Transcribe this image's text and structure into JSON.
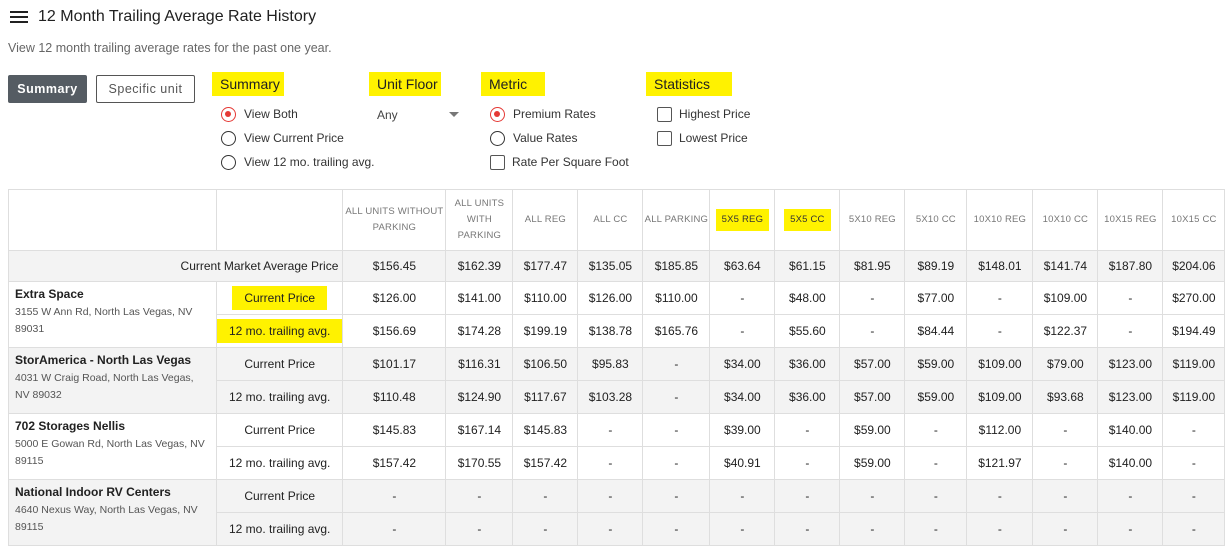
{
  "header": {
    "title": "12 Month Trailing Average Rate History",
    "subtitle": "View 12 month trailing average rates for the past one year."
  },
  "view_buttons": {
    "summary": "Summary",
    "specific_unit": "Specific unit"
  },
  "filters": {
    "summary": {
      "heading": "Summary",
      "options": [
        {
          "label": "View Both",
          "selected": true
        },
        {
          "label": "View Current Price",
          "selected": false
        },
        {
          "label": "View 12 mo. trailing avg.",
          "selected": false
        }
      ]
    },
    "unit_floor": {
      "heading": "Unit Floor",
      "value": "Any"
    },
    "metric": {
      "heading": "Metric",
      "options": [
        {
          "label": "Premium Rates",
          "selected": true
        },
        {
          "label": "Value Rates",
          "selected": false
        }
      ],
      "checkbox": {
        "label": "Rate Per Square Foot",
        "checked": false
      }
    },
    "statistics": {
      "heading": "Statistics",
      "checkboxes": [
        {
          "label": "Highest Price",
          "checked": false
        },
        {
          "label": "Lowest Price",
          "checked": false
        }
      ]
    }
  },
  "table": {
    "columns": [
      "ALL UNITS WITHOUT PARKING",
      "ALL UNITS WITH PARKING",
      "ALL REG",
      "ALL CC",
      "ALL PARKING",
      "5X5 REG",
      "5X5 CC",
      "5X10 REG",
      "5X10 CC",
      "10X10 REG",
      "10X10 CC",
      "10X15 REG",
      "10X15 CC"
    ],
    "market_row": {
      "label": "Current Market Average Price",
      "values": [
        "$156.45",
        "$162.39",
        "$177.47",
        "$135.05",
        "$185.85",
        "$63.64",
        "$61.15",
        "$81.95",
        "$89.19",
        "$148.01",
        "$141.74",
        "$187.80",
        "$204.06"
      ]
    },
    "facilities": [
      {
        "name": "Extra Space",
        "address": "3155 W Ann Rd, North Las Vegas, NV 89031",
        "rows": [
          {
            "label": "Current Price",
            "values": [
              "$126.00",
              "$141.00",
              "$110.00",
              "$126.00",
              "$110.00",
              "-",
              "$48.00",
              "-",
              "$77.00",
              "-",
              "$109.00",
              "-",
              "$270.00"
            ]
          },
          {
            "label": "12 mo. trailing avg.",
            "values": [
              "$156.69",
              "$174.28",
              "$199.19",
              "$138.78",
              "$165.76",
              "-",
              "$55.60",
              "-",
              "$84.44",
              "-",
              "$122.37",
              "-",
              "$194.49"
            ]
          }
        ]
      },
      {
        "name": "StorAmerica - North Las Vegas",
        "address": "4031 W Craig Road, North Las Vegas, NV 89032",
        "rows": [
          {
            "label": "Current Price",
            "values": [
              "$101.17",
              "$116.31",
              "$106.50",
              "$95.83",
              "-",
              "$34.00",
              "$36.00",
              "$57.00",
              "$59.00",
              "$109.00",
              "$79.00",
              "$123.00",
              "$119.00"
            ]
          },
          {
            "label": "12 mo. trailing avg.",
            "values": [
              "$110.48",
              "$124.90",
              "$117.67",
              "$103.28",
              "-",
              "$34.00",
              "$36.00",
              "$57.00",
              "$59.00",
              "$109.00",
              "$93.68",
              "$123.00",
              "$119.00"
            ]
          }
        ]
      },
      {
        "name": "702 Storages Nellis",
        "address": "5000 E Gowan Rd, North Las Vegas, NV 89115",
        "rows": [
          {
            "label": "Current Price",
            "values": [
              "$145.83",
              "$167.14",
              "$145.83",
              "-",
              "-",
              "$39.00",
              "-",
              "$59.00",
              "-",
              "$112.00",
              "-",
              "$140.00",
              "-"
            ]
          },
          {
            "label": "12 mo. trailing avg.",
            "values": [
              "$157.42",
              "$170.55",
              "$157.42",
              "-",
              "-",
              "$40.91",
              "-",
              "$59.00",
              "-",
              "$121.97",
              "-",
              "$140.00",
              "-"
            ]
          }
        ]
      },
      {
        "name": "National Indoor RV Centers",
        "address": "4640 Nexus Way, North Las Vegas, NV 89115",
        "rows": [
          {
            "label": "Current Price",
            "values": [
              "-",
              "-",
              "-",
              "-",
              "-",
              "-",
              "-",
              "-",
              "-",
              "-",
              "-",
              "-",
              "-"
            ]
          },
          {
            "label": "12 mo. trailing avg.",
            "values": [
              "-",
              "-",
              "-",
              "-",
              "-",
              "-",
              "-",
              "-",
              "-",
              "-",
              "-",
              "-",
              "-"
            ]
          }
        ]
      }
    ],
    "highlighted_columns": [
      5,
      6
    ],
    "highlight_color": "#fff200"
  },
  "colors": {
    "accent_radio": "#e53935",
    "highlight": "#fff200",
    "primary_button": "#555c63"
  }
}
